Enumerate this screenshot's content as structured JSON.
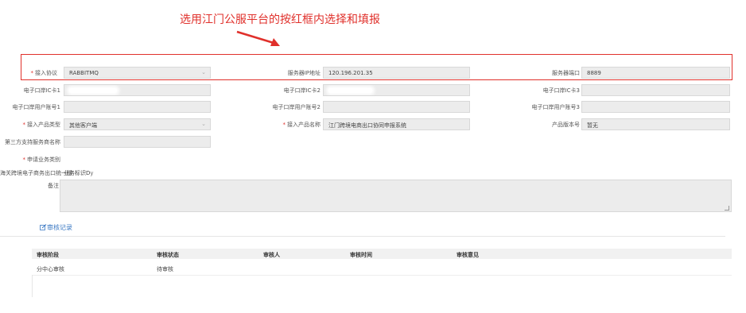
{
  "annotation": {
    "text": "选用江门公服平台的按红框内选择和填报"
  },
  "form": {
    "access_protocol": {
      "label": "接入协议",
      "value": "RABBITMQ"
    },
    "server_address": {
      "label": "服务器IP地址",
      "value": "120.196.201.35"
    },
    "server_port": {
      "label": "服务器端口",
      "value": "8889"
    },
    "ecard1": {
      "label": "电子口岸IC卡1",
      "value": ""
    },
    "ecard2": {
      "label": "电子口岸IC卡2",
      "value": ""
    },
    "ecard3": {
      "label": "电子口岸IC卡3",
      "value": ""
    },
    "eport_user1": {
      "label": "电子口岸用户账号1",
      "value": ""
    },
    "eport_user2": {
      "label": "电子口岸用户账号2",
      "value": ""
    },
    "eport_user3": {
      "label": "电子口岸用户账号3",
      "value": ""
    },
    "product_type": {
      "label": "接入产品类型",
      "value": "其他客户端"
    },
    "product_name": {
      "label": "接入产品名称",
      "value": "江门跨境电商出口协同申报系统"
    },
    "product_version": {
      "label": "产品版本号",
      "value": "暂无"
    },
    "third_party_name": {
      "label": "第三方支持服务商名称",
      "value": ""
    },
    "business_type": {
      "label": "申请业务类别"
    },
    "customs_line": {
      "label": "海关跨境电子商务出口统一版",
      "value": "业务标识Dy"
    },
    "remark": {
      "label": "备注"
    }
  },
  "audit_link": {
    "label": "审核记录"
  },
  "audit_table": {
    "headers": [
      "审核阶段",
      "审核状态",
      "审核人",
      "审核时间",
      "审核意见"
    ],
    "rows": [
      {
        "stage": "分中心审核",
        "status": "待审核",
        "auditor": "",
        "time": "",
        "opinion": ""
      }
    ]
  },
  "colors": {
    "annotation": "#e0302b",
    "link": "#3a78c3",
    "field_bg": "#ececec"
  },
  "icons": {
    "audit": "edit-icon",
    "select": "chevron-down-icon"
  }
}
